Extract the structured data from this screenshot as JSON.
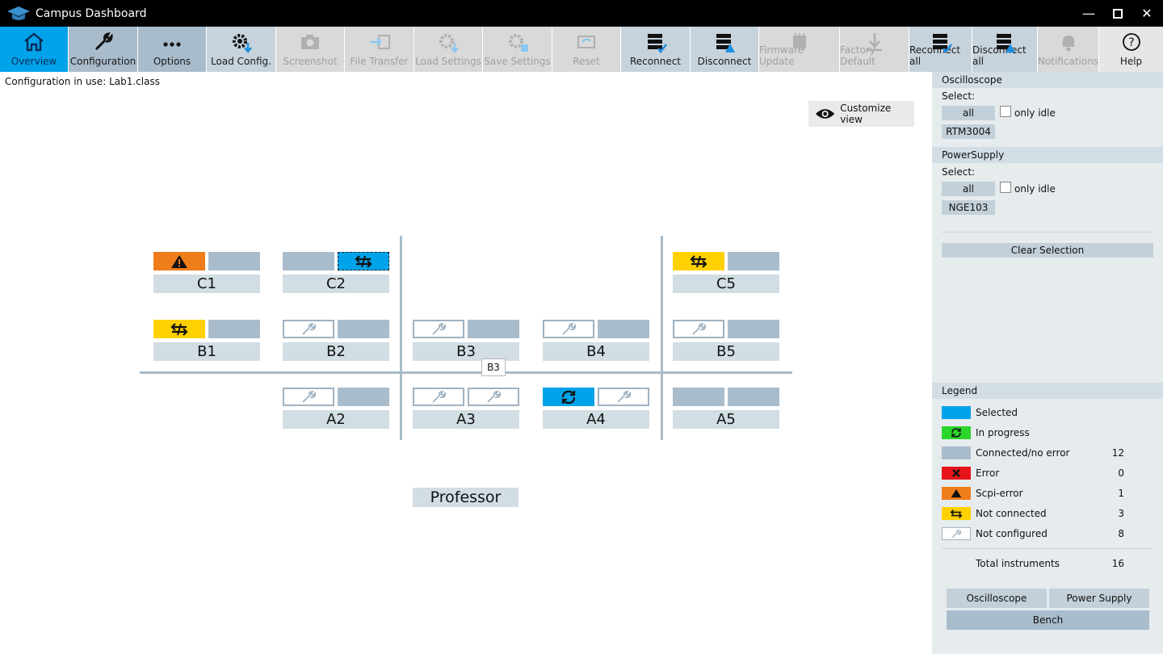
{
  "app": {
    "title": "Campus Dashboard"
  },
  "toolbar": {
    "overview": "Overview",
    "configuration": "Configuration",
    "options": "Options",
    "load_config": "Load Config.",
    "screenshot": "Screenshot",
    "file_transfer": "File Transfer",
    "load_settings": "Load Settings",
    "save_settings": "Save Settings",
    "reset": "Reset",
    "reconnect": "Reconnect",
    "disconnect": "Disconnect",
    "firmware_update": "Firmware Update",
    "factory_default": "Factory Default",
    "reconnect_all": "Reconnect all",
    "disconnect_all": "Disconnect all",
    "notifications": "Notifications",
    "help": "Help"
  },
  "config": {
    "label": "Configuration in use:",
    "file": "Lab1.class"
  },
  "customize_view": "Customize view",
  "seats": {
    "c1": "C1",
    "c2": "C2",
    "c5": "C5",
    "b1": "B1",
    "b2": "B2",
    "b3": "B3",
    "b4": "B4",
    "b5": "B5",
    "a2": "A2",
    "a3": "A3",
    "a4": "A4",
    "a5": "A5"
  },
  "tooltip": "B3",
  "professor": "Professor",
  "sidebar": {
    "oscilloscope": {
      "header": "Oscilloscope",
      "select": "Select:",
      "all": "all",
      "only_idle": "only idle",
      "device": "RTM3004"
    },
    "powersupply": {
      "header": "PowerSupply",
      "select": "Select:",
      "all": "all",
      "only_idle": "only idle",
      "device": "NGE103"
    },
    "clear_selection": "Clear Selection",
    "legend": {
      "header": "Legend",
      "items": [
        {
          "label": "Selected",
          "count": ""
        },
        {
          "label": "In progress",
          "count": ""
        },
        {
          "label": "Connected/no error",
          "count": "12"
        },
        {
          "label": "Error",
          "count": "0"
        },
        {
          "label": "Scpi-error",
          "count": "1"
        },
        {
          "label": "Not connected",
          "count": "3"
        },
        {
          "label": "Not configured",
          "count": "8"
        }
      ],
      "total_label": "Total instruments",
      "total_count": "16"
    },
    "bottom": {
      "oscilloscope": "Oscilloscope",
      "power_supply": "Power Supply",
      "bench": "Bench"
    }
  },
  "colors": {
    "selected": "#00a3ea",
    "in_progress": "#2bd52b",
    "connected": "#a9bccb",
    "error": "#e8141b",
    "scpi_error": "#ef7d1a",
    "not_connected": "#ffd100",
    "not_configured": "#ffffff"
  }
}
